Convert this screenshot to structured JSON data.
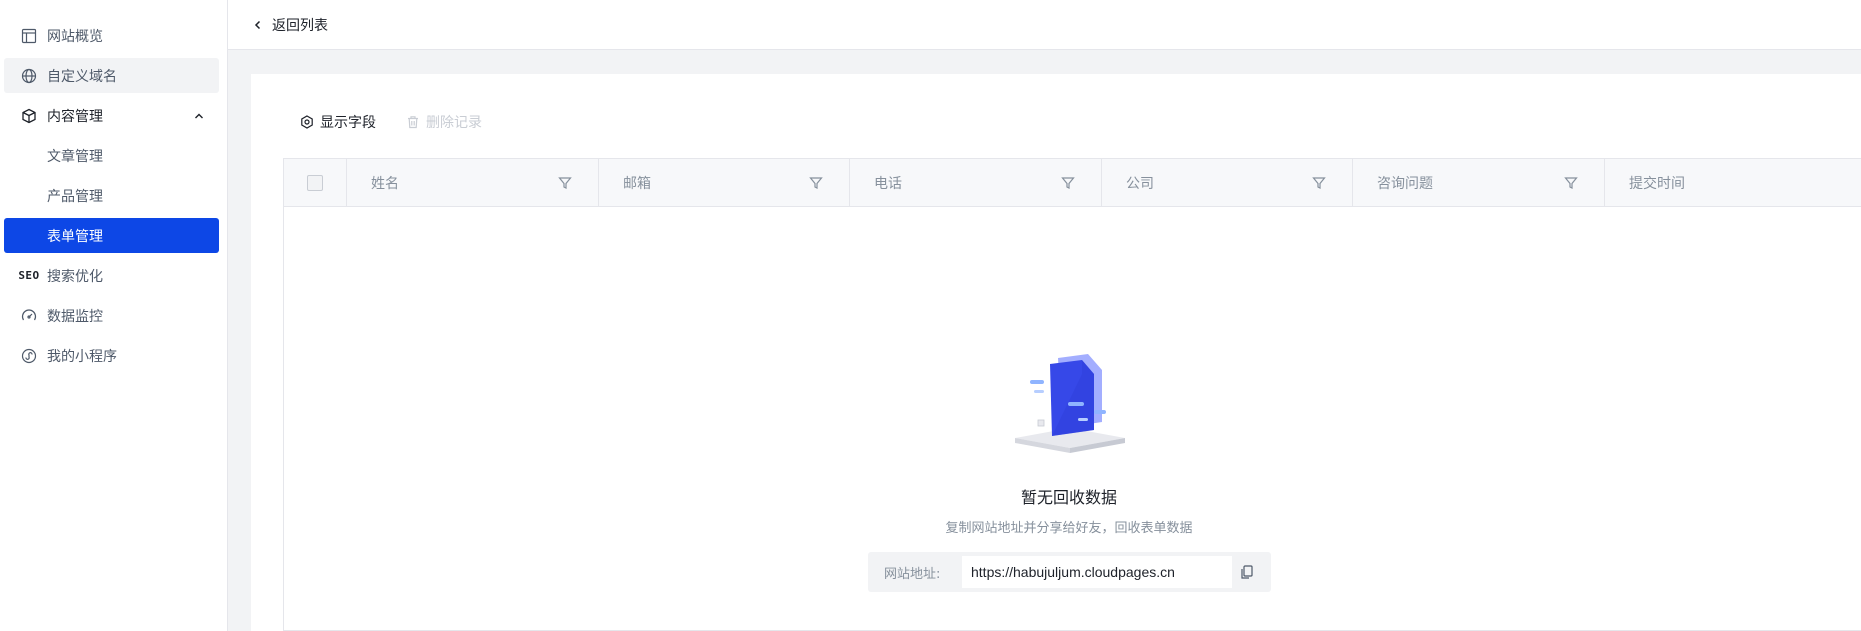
{
  "sidebar": {
    "items": [
      {
        "label": "网站概览",
        "icon": "layout-icon"
      },
      {
        "label": "自定义域名",
        "icon": "globe-icon"
      },
      {
        "label": "内容管理",
        "icon": "box-icon"
      },
      {
        "label": "文章管理"
      },
      {
        "label": "产品管理"
      },
      {
        "label": "表单管理"
      },
      {
        "label": "搜索优化",
        "icon_text": "SEO"
      },
      {
        "label": "数据监控",
        "icon": "gauge-icon"
      },
      {
        "label": "我的小程序",
        "icon": "miniapp-icon"
      }
    ]
  },
  "topbar": {
    "back_label": "返回列表"
  },
  "toolbar": {
    "show_fields": "显示字段",
    "delete_records": "删除记录"
  },
  "table": {
    "columns": [
      "姓名",
      "邮箱",
      "电话",
      "公司",
      "咨询问题",
      "提交时间"
    ]
  },
  "empty": {
    "title": "暂无回收数据",
    "subtitle": "复制网站地址并分享给好友，回收表单数据",
    "url_label": "网站地址:",
    "url_value": "https://habujuljum.cloudpages.cn"
  },
  "colors": {
    "accent": "#0d47e6",
    "muted": "#86909c",
    "bg": "#f2f3f5"
  }
}
